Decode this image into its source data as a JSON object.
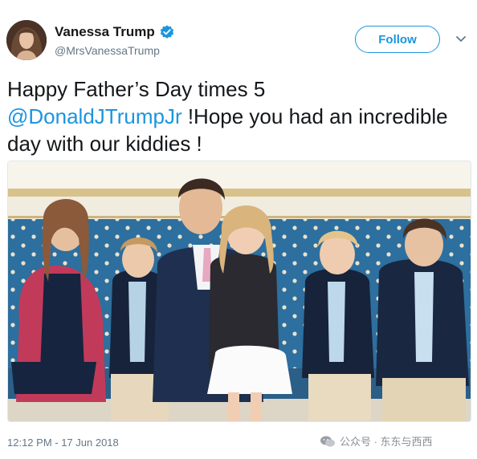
{
  "tweet": {
    "display_name": "Vanessa Trump",
    "handle": "@MrsVanessaTrump",
    "follow_label": "Follow",
    "text_before": "Happy Father’s Day times 5",
    "mention": "@DonaldJTrumpJr",
    "text_after": " !Hope you had an incredible day with our kiddies !",
    "timestamp": "12:12 PM - 17 Jun 2018"
  },
  "watermark": {
    "text": "公众号 · 东东与西西"
  },
  "colors": {
    "accent": "#1b95e0",
    "secondary_text": "#657786",
    "primary_text": "#14171a"
  },
  "icons": {
    "verified": "verified-badge-icon",
    "more": "chevron-down-icon",
    "watermark": "wechat-icon"
  }
}
